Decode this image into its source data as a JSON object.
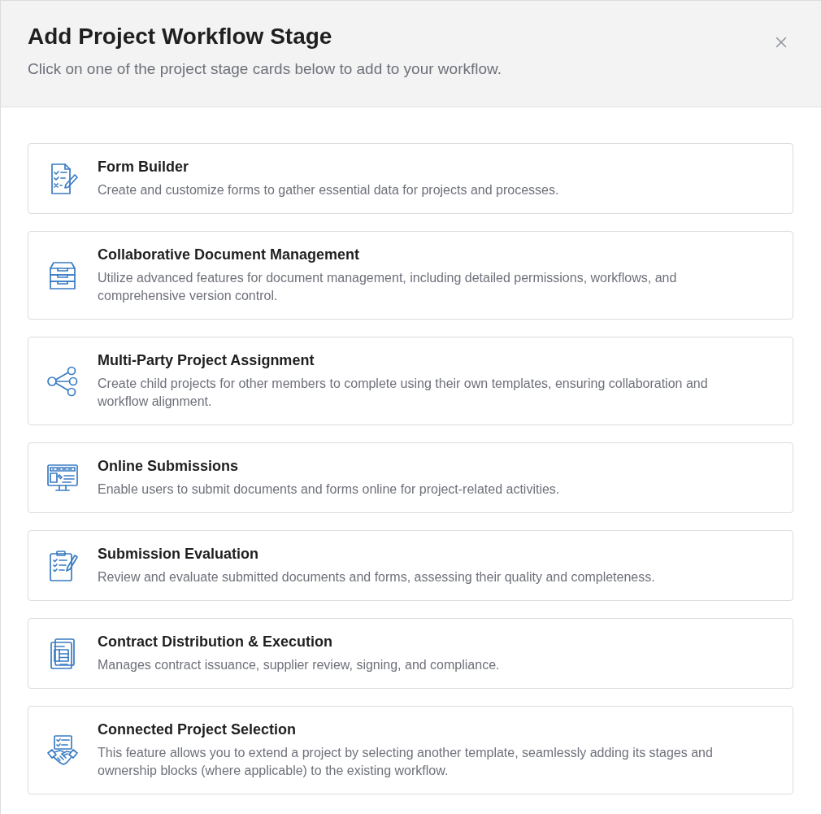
{
  "dialog": {
    "title": "Add Project Workflow Stage",
    "subtitle": "Click on one of the project stage cards below to add to your workflow."
  },
  "stages": [
    {
      "title": "Form Builder",
      "description": "Create and customize forms to gather essential data for projects and processes."
    },
    {
      "title": "Collaborative Document Management",
      "description": "Utilize advanced features for document management, including detailed permissions, workflows, and comprehensive version control."
    },
    {
      "title": "Multi-Party Project Assignment",
      "description": "Create child projects for other members to complete using their own templates, ensuring collaboration and workflow alignment."
    },
    {
      "title": "Online Submissions",
      "description": "Enable users to submit documents and forms online for project-related activities."
    },
    {
      "title": "Submission Evaluation",
      "description": "Review and evaluate submitted documents and forms, assessing their quality and completeness."
    },
    {
      "title": "Contract Distribution & Execution",
      "description": "Manages contract issuance, supplier review, signing, and compliance."
    },
    {
      "title": "Connected Project Selection",
      "description": "This feature allows you to extend a project by selecting another template, seamlessly adding its stages and ownership blocks (where applicable) to the existing workflow."
    }
  ]
}
